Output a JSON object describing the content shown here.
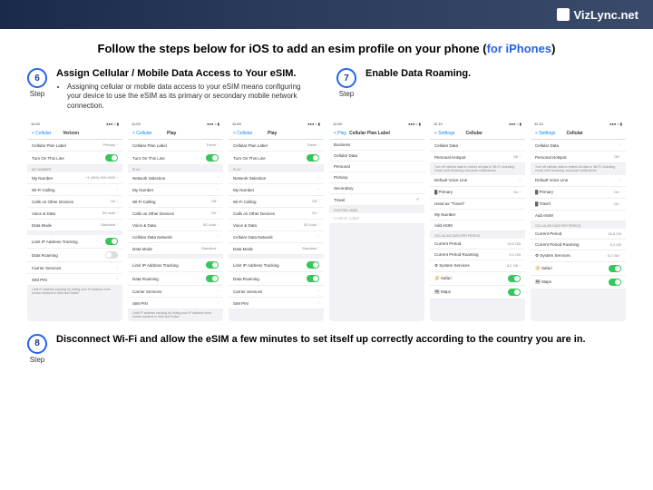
{
  "brand": "VizLync.net",
  "title_main": "Follow the steps below for iOS to add an esim profile on your phone (",
  "title_link": "for iPhones",
  "title_end": ")",
  "step6": {
    "num": "6",
    "label": "Step",
    "title": "Assign Cellular / Mobile Data Access to Your eSIM.",
    "bullet": "Assigning cellular or mobile data access to your eSIM means configuring your device to use the eSIM as its primary or secondary mobile network connection."
  },
  "step7": {
    "num": "7",
    "label": "Step",
    "title": "Enable Data Roaming."
  },
  "step8": {
    "num": "8",
    "label": "Step",
    "title": "Disconnect Wi-Fi and allow the eSIM a few minutes to set itself up correctly according to the country you are in."
  },
  "phones": {
    "time": "11:09",
    "time2": "11:10",
    "status_right": "●●● ≈ ▮",
    "p1": {
      "back": "< Cellular",
      "title": "Verizon",
      "rows": [
        [
          "Cellular Plan Label",
          "Primary >"
        ],
        [
          "Turn On This Line",
          "on"
        ]
      ],
      "sec2": "MY NUMBER",
      "rows2": [
        [
          "My Number",
          "+1 (000) 000-0000 >"
        ],
        [
          "Wi-Fi Calling",
          ">"
        ],
        [
          "Calls on Other Devices",
          "On >"
        ],
        [
          "Voice & Data",
          "5G Auto >"
        ],
        [
          "Data Mode",
          "Standard >"
        ]
      ],
      "rows3": [
        [
          "Limit IP Address Tracking",
          "on"
        ],
        [
          "Data Roaming",
          "off"
        ],
        [
          "Carrier Services",
          ">"
        ],
        [
          "SIM PIN",
          ">"
        ]
      ],
      "foot": "Limit IP address tracking by hiding your IP address from known trackers in Mail and Safari."
    },
    "p2": {
      "back": "< Cellular",
      "title": "Play",
      "rows": [
        [
          "Cellular Plan Label",
          "Travel >"
        ],
        [
          "Turn On This Line",
          "on"
        ]
      ],
      "sec2": "PLAY",
      "rows2": [
        [
          "Network Selection",
          ">"
        ],
        [
          "My Number",
          ">"
        ],
        [
          "Wi-Fi Calling",
          "Off >"
        ],
        [
          "Calls on Other Devices",
          "On >"
        ],
        [
          "Voice & Data",
          "5G Auto >"
        ],
        [
          "Cellular Data Network",
          ">"
        ],
        [
          "Data Mode",
          "Standard >"
        ]
      ],
      "rows3": [
        [
          "Limit IP Address Tracking",
          "on"
        ],
        [
          "Data Roaming",
          "on"
        ],
        [
          "Carrier Services",
          ">"
        ],
        [
          "SIM PIN",
          ">"
        ]
      ],
      "foot": "Limit IP address tracking by hiding your IP address from known trackers in Mail and Safari."
    },
    "p3": {
      "back": "< Cellular",
      "title": "Play",
      "rows": [
        [
          "Cellular Plan Label",
          "Travel >"
        ],
        [
          "Turn On This Line",
          "on"
        ]
      ],
      "sec2": "PLAY",
      "rows2": [
        [
          "Network Selection",
          ">"
        ],
        [
          "My Number",
          ">"
        ],
        [
          "Wi-Fi Calling",
          "Off >"
        ],
        [
          "Calls on Other Devices",
          "On >"
        ],
        [
          "Voice & Data",
          "5G Auto >"
        ],
        [
          "Cellular Data Network",
          ">"
        ],
        [
          "Data Mode",
          "Standard >"
        ]
      ],
      "rows3": [
        [
          "Limit IP Address Tracking",
          "on"
        ],
        [
          "Data Roaming",
          "on"
        ],
        [
          "Carrier Services",
          ">"
        ],
        [
          "SIM PIN",
          ">"
        ]
      ],
      "foot": ""
    },
    "p4": {
      "back": "< Play",
      "title": "Cellular Plan Label",
      "opts": [
        "Business",
        "Cellular Data",
        "Personal",
        "Primary",
        "Secondary",
        "Travel"
      ],
      "checked": 5,
      "sec2": "CUSTOM LABEL",
      "custom": "Custom Label"
    },
    "p5": {
      "back": "< Settings",
      "title": "Cellular",
      "rows": [
        [
          "Cellular Data",
          ">"
        ],
        [
          "Personal Hotspot",
          "Off >"
        ]
      ],
      "foot1": "Turn off cellular data to restrict all data to Wi-Fi, including email, web browsing, and push notifications.",
      "rows2": [
        [
          "Default Voice Line",
          ">"
        ],
        [
          "▓ Primary",
          "On >"
        ],
        [
          "Used as \"Travel\"",
          ""
        ],
        [
          "My Number",
          ""
        ],
        [
          "Add eSIM",
          ""
        ]
      ],
      "sec3": "CELLULAR DATA PER PERIOD",
      "rows3": [
        [
          "Current Period",
          "33.5 GB"
        ],
        [
          "Current Period Roaming",
          "5.2 GB"
        ],
        [
          "⚙ System Services",
          "8.2 GB >"
        ],
        [
          "🧭 Safari",
          "on"
        ],
        [
          "🗺 Maps",
          "on"
        ]
      ]
    },
    "p6": {
      "back": "< Settings",
      "title": "Cellular",
      "rows": [
        [
          "Cellular Data",
          ">"
        ],
        [
          "Personal Hotspot",
          "Off >"
        ]
      ],
      "foot1": "Turn off cellular data to restrict all data to Wi-Fi, including email, web browsing, and push notifications.",
      "rows2": [
        [
          "Default Voice Line",
          ">"
        ],
        [
          "▓ Primary",
          "On >"
        ],
        [
          "▓ Travel",
          "On >"
        ],
        [
          "Add eSIM",
          ""
        ]
      ],
      "sec3": "CELLULAR DATA PER PERIOD",
      "rows3": [
        [
          "Current Period",
          "33.8 GB"
        ],
        [
          "Current Period Roaming",
          "5.2 GB"
        ],
        [
          "⚙ System Services",
          "8.2 GB >"
        ],
        [
          "🧭 Safari",
          "on"
        ],
        [
          "🗺 Maps",
          "on"
        ]
      ]
    }
  }
}
